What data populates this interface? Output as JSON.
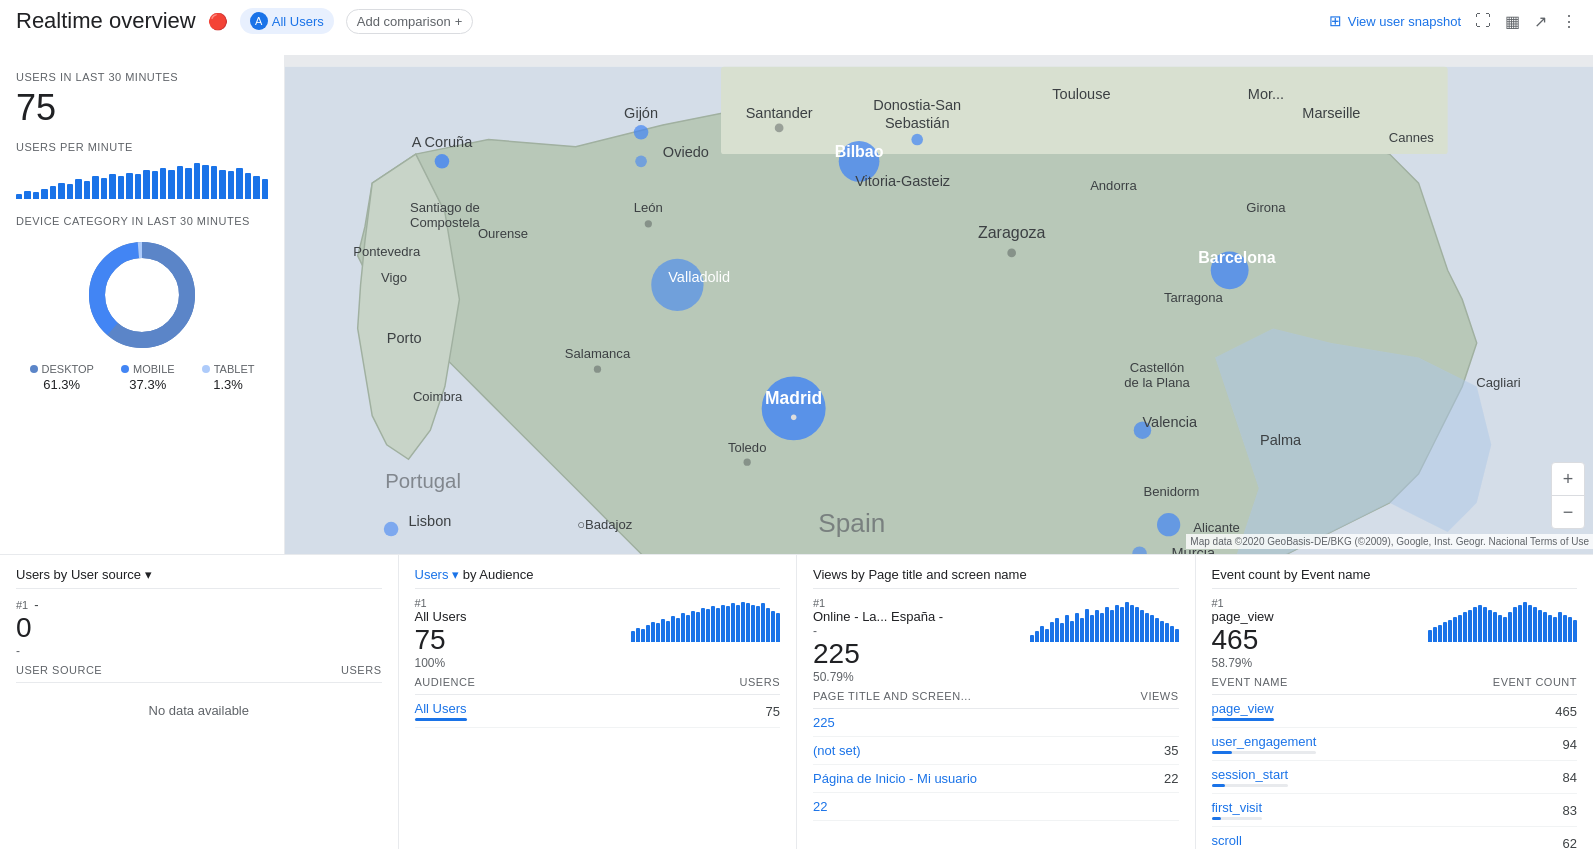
{
  "header": {
    "title": "Realtime overview",
    "title_icon": "📊",
    "user_chip": {
      "label": "All Users",
      "avatar": "A"
    },
    "add_comparison_label": "Add comparison",
    "actions": {
      "snapshot": "View user snapshot",
      "expand": "⛶",
      "chart": "📊",
      "share": "↗"
    }
  },
  "left_panel": {
    "users_label": "USERS IN LAST 30 MINUTES",
    "users_count": "75",
    "users_per_minute_label": "USERS PER MINUTE",
    "device_label": "DEVICE CATEGORY IN LAST 30 MINUTES",
    "devices": [
      {
        "name": "DESKTOP",
        "dot_color": "#5b85c8",
        "pct": "61.3%"
      },
      {
        "name": "MOBILE",
        "dot_color": "#4285f4",
        "pct": "37.3%"
      },
      {
        "name": "TABLET",
        "dot_color": "#aecbfa",
        "pct": "1.3%"
      }
    ],
    "bars": [
      3,
      5,
      4,
      6,
      8,
      10,
      9,
      12,
      11,
      14,
      13,
      15,
      14,
      16,
      15,
      18,
      17,
      19,
      18,
      20,
      19,
      22,
      21,
      20,
      18,
      17,
      19,
      16,
      14,
      12
    ]
  },
  "bottom_panels": {
    "user_source": {
      "title": "Users by User source",
      "rank": "#1",
      "rank_name": "-",
      "count": "0",
      "dash": "-",
      "col1": "USER SOURCE",
      "col2": "USERS",
      "no_data": "No data available"
    },
    "audience": {
      "title": "Users",
      "title_by": "by Audience",
      "rank": "#1",
      "rank_name": "All Users",
      "count": "75",
      "pct": "100%",
      "col1": "AUDIENCE",
      "col2": "USERS",
      "rows": [
        {
          "label": "All Users",
          "value": "75",
          "progress": 100
        }
      ],
      "bars": [
        8,
        10,
        9,
        12,
        14,
        13,
        16,
        15,
        18,
        17,
        20,
        19,
        22,
        21,
        24,
        23,
        25,
        24,
        26,
        25,
        27,
        26,
        28,
        27,
        26,
        25,
        27,
        24,
        22,
        20
      ]
    },
    "views": {
      "title": "Views by Page title and screen name",
      "rank": "#1",
      "rank_name": "Online - La... España -",
      "rank_sub": "-",
      "count": "225",
      "pct": "50.79%",
      "col1": "PAGE TITLE AND SCREEN...",
      "col2": "VIEWS",
      "rows": [
        {
          "label": "",
          "value": "225"
        },
        {
          "label": "(not set)",
          "value": "35"
        },
        {
          "label": "Página de Inicio - Mi usuario",
          "value": "22"
        },
        {
          "label": "",
          "value": "22"
        }
      ],
      "bars": [
        5,
        8,
        12,
        10,
        15,
        18,
        14,
        20,
        16,
        22,
        18,
        25,
        20,
        24,
        22,
        26,
        24,
        28,
        26,
        30,
        28,
        26,
        24,
        22,
        20,
        18,
        16,
        14,
        12,
        10
      ]
    },
    "events": {
      "title": "Event count by Event name",
      "rank": "#1",
      "rank_name": "page_view",
      "count": "465",
      "pct": "58.79%",
      "col1": "EVENT NAME",
      "col2": "EVENT COUNT",
      "rows": [
        {
          "label": "page_view",
          "value": "465",
          "progress": 100
        },
        {
          "label": "user_engagement",
          "value": "94",
          "progress": 20
        },
        {
          "label": "session_start",
          "value": "84",
          "progress": 18
        },
        {
          "label": "first_visit",
          "value": "83",
          "progress": 18
        },
        {
          "label": "scroll",
          "value": "62",
          "progress": 13
        }
      ],
      "bars": [
        10,
        12,
        14,
        16,
        18,
        20,
        22,
        24,
        26,
        28,
        30,
        28,
        26,
        24,
        22,
        20,
        24,
        28,
        30,
        32,
        30,
        28,
        26,
        24,
        22,
        20,
        24,
        22,
        20,
        18
      ]
    }
  },
  "map": {
    "attribution": "Map data ©2020 GeoBasis-DE/BKG (©2009), Google, Inst. Geogr. Nacional   Terms of Use"
  }
}
